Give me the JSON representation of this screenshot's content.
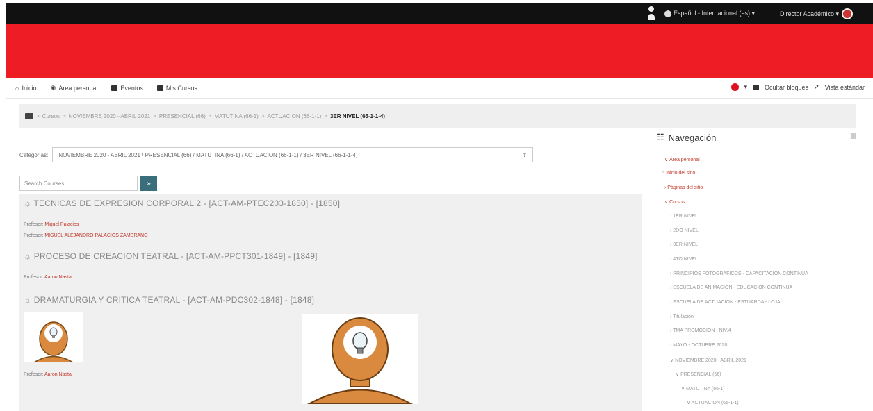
{
  "topbar": {
    "language": "Español - Internacional (es) ▾",
    "user": "Director Académico ▾"
  },
  "navbar": {
    "items": [
      {
        "label": "Inicio",
        "icon": "home-icon"
      },
      {
        "label": "Área personal",
        "icon": "dashboard-icon"
      },
      {
        "label": "Eventos",
        "icon": "calendar-icon"
      },
      {
        "label": "Mis Cursos",
        "icon": "courses-icon"
      }
    ],
    "hide_blocks": "Ocultar bloques",
    "standard_view": "Vista estándar"
  },
  "breadcrumb": {
    "items": [
      "Cursos",
      "NOVIEMBRE 2020 - ABRIL 2021",
      "PRESENCIAL (66)",
      "MATUTINA (66-1)",
      "ACTUACION (66-1-1)"
    ],
    "current": "3ER NIVEL (66-1-1-4)",
    "separator": ">"
  },
  "main": {
    "category_label": "Categorías:",
    "category_value": "NOVIEMBRE 2020 - ABRIL 2021 / PRESENCIAL (66) / MATUTINA (66-1) / ACTUACION (66-1-1) / 3ER NIVEL (66-1-1-4)",
    "search_placeholder": "Search Courses",
    "search_button": "»"
  },
  "courses": [
    {
      "title": "TECNICAS DE EXPRESION CORPORAL 2 - [ACT-AM-PTEC203-1850] - [1850]",
      "teachers": [
        {
          "label": "Profesor:",
          "name": "Miguel Palacios"
        },
        {
          "label": "Profesor:",
          "name": "MIGUEL ALEJANDRO PALACIOS ZAMBRANO"
        }
      ]
    },
    {
      "title": "PROCESO DE CREACION TEATRAL - [ACT-AM-PPCT301-1849] - [1849]",
      "teachers": [
        {
          "label": "Profesor:",
          "name": "Aaron Nasta"
        }
      ]
    },
    {
      "title": "DRAMATURGIA Y CRITICA TEATRAL - [ACT-AM-PDC302-1848] - [1848]",
      "teachers": [
        {
          "label": "Profesor:",
          "name": "Aaron Nasta"
        }
      ]
    }
  ],
  "sidebar": {
    "title": "Navegación",
    "items": [
      {
        "label": "∨ Área personal",
        "style": "red"
      },
      {
        "label": "Inicio del sitio",
        "style": "red"
      },
      {
        "label": "› Páginas del sitio",
        "style": "red"
      },
      {
        "label": "∨ Cursos",
        "style": "red"
      },
      {
        "label": "› 1ER NIVEL",
        "style": "grey"
      },
      {
        "label": "› 2DO NIVEL",
        "style": "grey"
      },
      {
        "label": "› 3ER NIVEL",
        "style": "grey"
      },
      {
        "label": "› 4TO NIVEL",
        "style": "grey"
      },
      {
        "label": "› PRINCIPIOS FOTOGRAFICOS - CAPACITACION CONTINUA",
        "style": "grey"
      },
      {
        "label": "› ESCUELA DE ANIMACION - EDUCACION CONTINUA",
        "style": "grey"
      },
      {
        "label": "› ESCUELA DE ACTUACION - ESTUARDA - LOJA",
        "style": "grey"
      },
      {
        "label": "› Titulación",
        "style": "grey"
      },
      {
        "label": "› TMA PROMOCION - NIV.4",
        "style": "grey"
      },
      {
        "label": "› MAYO - OCTUBRE 2020",
        "style": "grey"
      },
      {
        "label": "∨ NOVIEMBRE 2020 - ABRIL 2021",
        "style": "grey"
      },
      {
        "label": "∨ PRESENCIAL (66)",
        "style": "grey"
      },
      {
        "label": "∨ MATUTINA (66-1)",
        "style": "grey"
      },
      {
        "label": "∨ ACTUACION (66-1-1)",
        "style": "grey"
      }
    ]
  }
}
